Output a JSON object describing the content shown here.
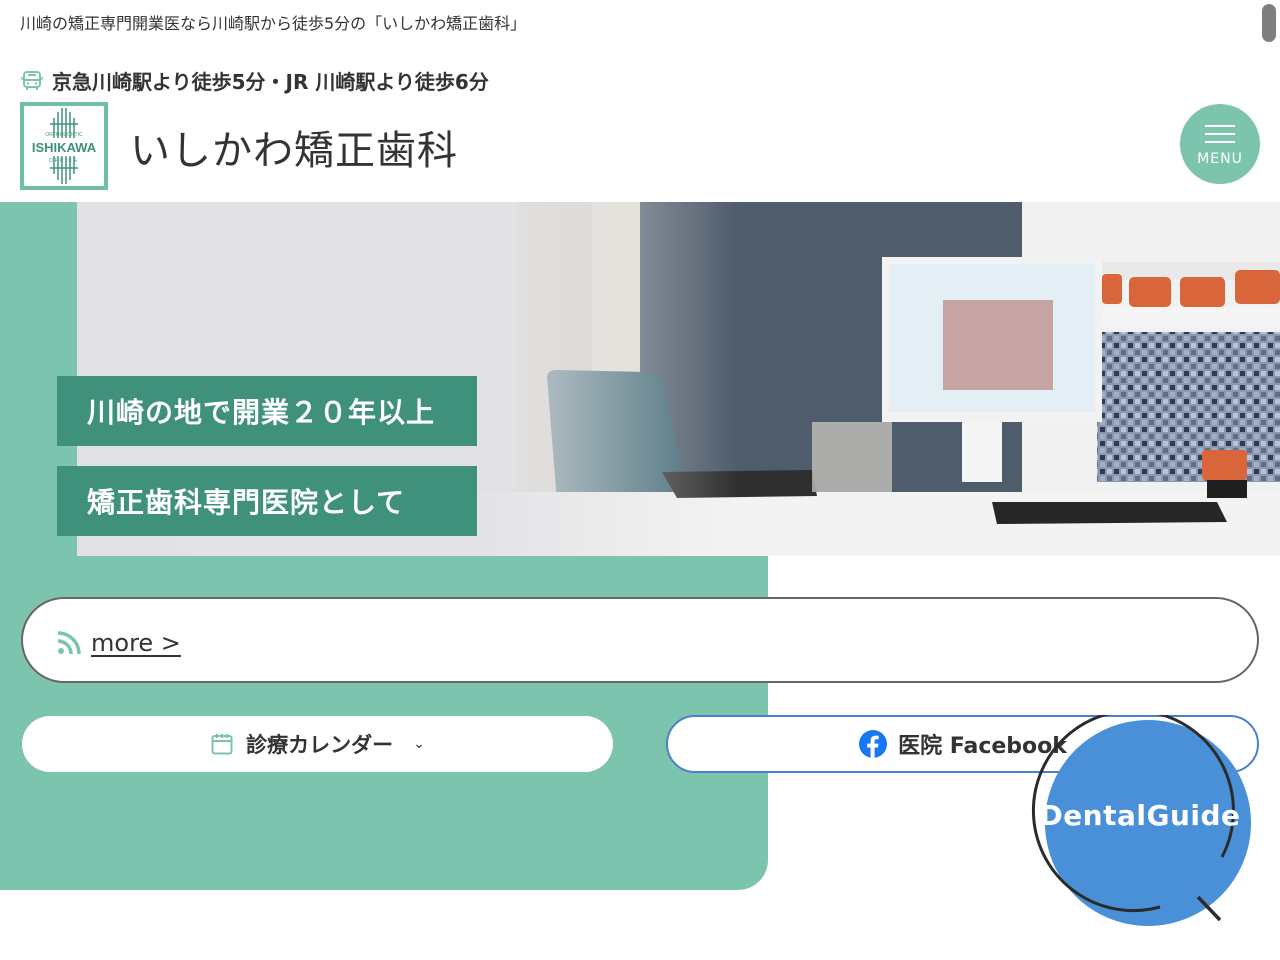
{
  "header": {
    "tagline": "川崎の矯正専門開業医なら川崎駅から徒歩5分の「いしかわ矯正歯科」",
    "access": "京急川崎駅より徒歩5分・JR 川崎駅より徒歩6分",
    "access_icon": "bus-icon",
    "site_title": "いしかわ矯正歯科",
    "logo": {
      "top_text": "ORTHODONTIC",
      "main_text": "ISHIKAWA",
      "bottom_text": "OFFICE"
    },
    "menu_label": "MENU"
  },
  "hero": {
    "banners": [
      "川崎の地で開業２０年以上",
      "矯正歯科専門医院として"
    ]
  },
  "news": {
    "more_label": "more >",
    "icon": "rss-icon"
  },
  "buttons": {
    "calendar_label": "診療カレンダー",
    "calendar_icon": "calendar-icon",
    "facebook_label": "医院 Facebook",
    "facebook_icon": "facebook-icon",
    "dental_guide_label": "DentalGuide"
  },
  "colors": {
    "teal": "#7cc4ae",
    "teal_dark": "#3f917c",
    "facebook_blue": "#1877f2",
    "dental_guide_blue": "#4a90d9"
  }
}
